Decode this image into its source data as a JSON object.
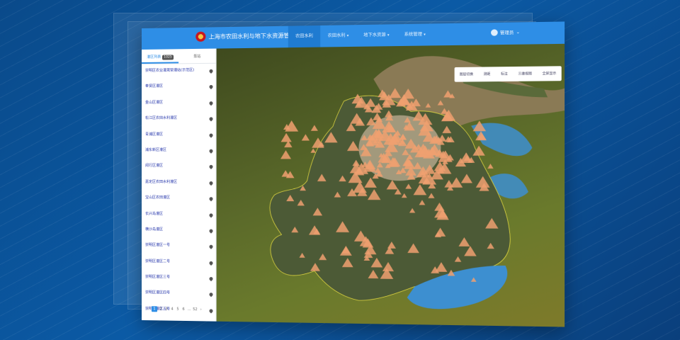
{
  "app": {
    "title": "上海市农田水利与地下水资源管理平台"
  },
  "nav": {
    "items": [
      {
        "label": "农田水利",
        "has_arrow": false,
        "active": true
      },
      {
        "label": "农田水利",
        "has_arrow": true,
        "active": false
      },
      {
        "label": "地下水资源",
        "has_arrow": true,
        "active": false
      },
      {
        "label": "系统管理",
        "has_arrow": true,
        "active": false
      }
    ]
  },
  "user": {
    "name": "管理员"
  },
  "sidebar": {
    "tabs": [
      {
        "label": "灌区列表",
        "count": "1025"
      },
      {
        "label": "泵站"
      }
    ],
    "items": [
      {
        "label": "崇明区农业灌溉管理站(示范区)"
      },
      {
        "label": "奉贤区灌区"
      },
      {
        "label": "金山区灌区"
      },
      {
        "label": "松江区农田水利灌区"
      },
      {
        "label": "青浦区灌区"
      },
      {
        "label": "浦东新区灌区"
      },
      {
        "label": "闵行区灌区"
      },
      {
        "label": "嘉定区农田水利灌区"
      },
      {
        "label": "宝山区农田灌区"
      },
      {
        "label": "长兴岛灌区"
      },
      {
        "label": "横沙岛灌区"
      },
      {
        "label": "崇明区灌区一号"
      },
      {
        "label": "崇明区灌区二号"
      },
      {
        "label": "崇明区灌区三号"
      },
      {
        "label": "崇明区灌区四号"
      },
      {
        "label": "崇明区灌区五号"
      }
    ],
    "pager": {
      "prev": "‹",
      "pages": [
        "1",
        "2",
        "3",
        "4",
        "5",
        "6"
      ],
      "ellipsis": "...",
      "last": "52",
      "next": "›",
      "current": "1"
    }
  },
  "map": {
    "tools": [
      {
        "label": "图层切换"
      },
      {
        "label": "测距"
      },
      {
        "label": "标注"
      },
      {
        "label": "三维视图"
      },
      {
        "label": "全屏显示"
      }
    ]
  },
  "colors": {
    "header": "#2e8ee6",
    "water": "#3d8fd0",
    "river": "#8a7a55",
    "marker": "#f0a070"
  }
}
